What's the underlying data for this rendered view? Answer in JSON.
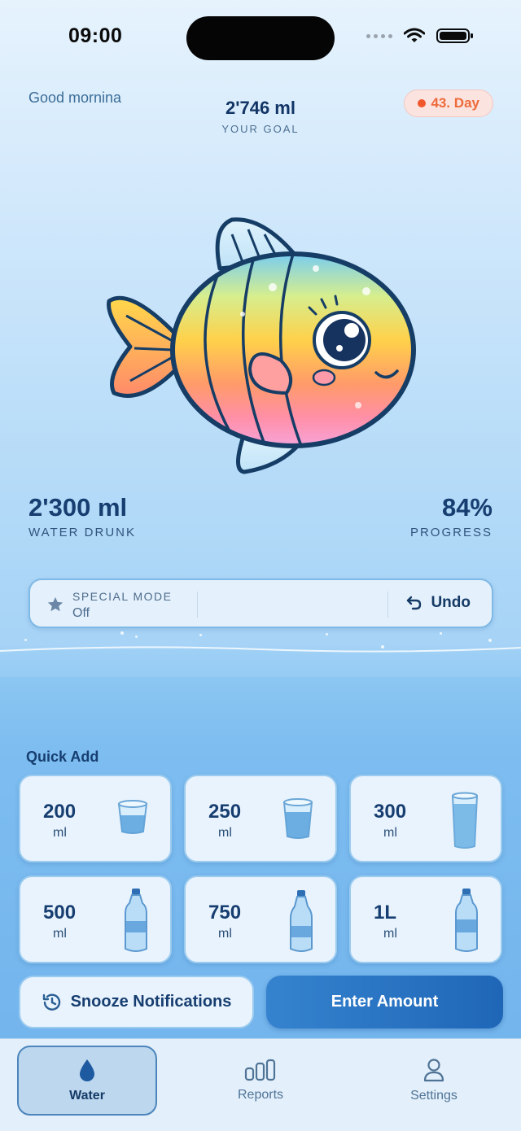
{
  "status_bar": {
    "time": "09:00"
  },
  "header": {
    "greeting": "Good mornina",
    "goal_value": "2'746 ml",
    "goal_label": "YOUR GOAL",
    "day_badge": "43. Day"
  },
  "stats": {
    "drunk_value": "2'300 ml",
    "drunk_label": "WATER DRUNK",
    "progress_value": "84%",
    "progress_label": "PROGRESS"
  },
  "mode": {
    "label": "SPECIAL MODE",
    "value": "Off",
    "undo_label": "Undo"
  },
  "quick_add": {
    "title": "Quick Add",
    "items": [
      {
        "amount": "200",
        "unit": "ml",
        "icon": "glass-icon"
      },
      {
        "amount": "250",
        "unit": "ml",
        "icon": "glass-icon"
      },
      {
        "amount": "300",
        "unit": "ml",
        "icon": "tall-glass-icon"
      },
      {
        "amount": "500",
        "unit": "ml",
        "icon": "bottle-icon"
      },
      {
        "amount": "750",
        "unit": "ml",
        "icon": "bottle-icon"
      },
      {
        "amount": "1L",
        "unit": "ml",
        "icon": "bottle-icon"
      }
    ]
  },
  "actions": {
    "snooze_label": "Snooze Notifications",
    "enter_label": "Enter Amount"
  },
  "tabs": [
    {
      "label": "Water",
      "icon": "water-drop-icon",
      "active": true
    },
    {
      "label": "Reports",
      "icon": "bar-chart-icon",
      "active": false
    },
    {
      "label": "Settings",
      "icon": "person-icon",
      "active": false
    }
  ],
  "colors": {
    "accent": "#1f66b7",
    "badge": "#ee6a3a",
    "text_dark": "#173e70"
  }
}
